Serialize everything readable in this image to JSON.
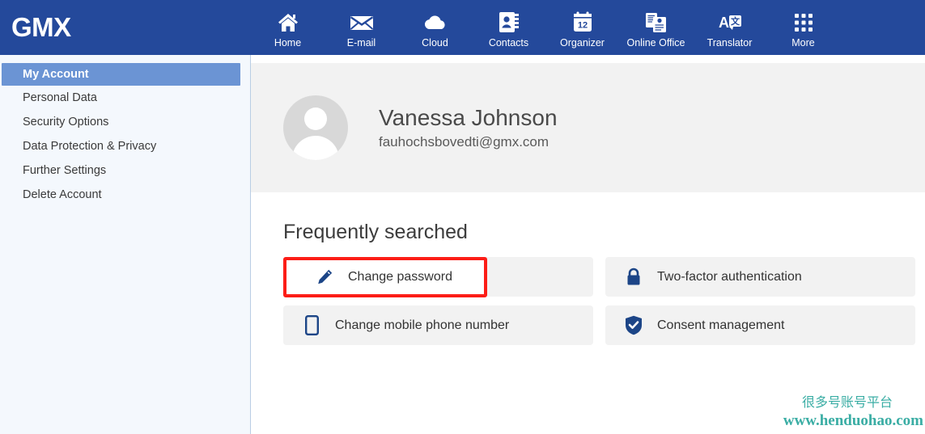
{
  "brand": {
    "name": "GMX"
  },
  "nav": {
    "items": [
      {
        "label": "Home",
        "icon": "home-icon"
      },
      {
        "label": "E-mail",
        "icon": "envelope-icon"
      },
      {
        "label": "Cloud",
        "icon": "cloud-icon"
      },
      {
        "label": "Contacts",
        "icon": "contacts-icon"
      },
      {
        "label": "Organizer",
        "icon": "calendar-icon",
        "badge": "12"
      },
      {
        "label": "Online Office",
        "icon": "documents-icon"
      },
      {
        "label": "Translator",
        "icon": "translator-icon"
      },
      {
        "label": "More",
        "icon": "grid-dots-icon"
      }
    ]
  },
  "sidebar": {
    "items": [
      {
        "label": "My Account",
        "active": true
      },
      {
        "label": "Personal Data",
        "active": false
      },
      {
        "label": "Security Options",
        "active": false
      },
      {
        "label": "Data Protection & Privacy",
        "active": false
      },
      {
        "label": "Further Settings",
        "active": false
      },
      {
        "label": "Delete Account",
        "active": false
      }
    ]
  },
  "profile": {
    "name": "Vanessa Johnson",
    "email": "fauhochsbovedti@gmx.com",
    "avatar_icon": "user-avatar-icon"
  },
  "main": {
    "section_title": "Frequently searched",
    "tiles": [
      {
        "label": "Change password",
        "icon": "pencil-icon",
        "highlighted": true
      },
      {
        "label": "Two-factor authentication",
        "icon": "lock-icon",
        "highlighted": false
      },
      {
        "label": "Change mobile phone number",
        "icon": "mobile-phone-icon",
        "highlighted": false
      },
      {
        "label": "Consent management",
        "icon": "shield-check-icon",
        "highlighted": false
      }
    ]
  },
  "watermark": {
    "chinese": "很多号账号平台",
    "url": "www.henduohao.com"
  },
  "colors": {
    "header_blue": "#24499b",
    "sidebar_active_blue": "#6b94d4",
    "sidebar_bg": "#f4f8fd",
    "tile_bg": "#f2f2f2",
    "icon_blue": "#1c4587",
    "highlight_red": "#fc1d17",
    "watermark_teal": "#3aada4"
  }
}
